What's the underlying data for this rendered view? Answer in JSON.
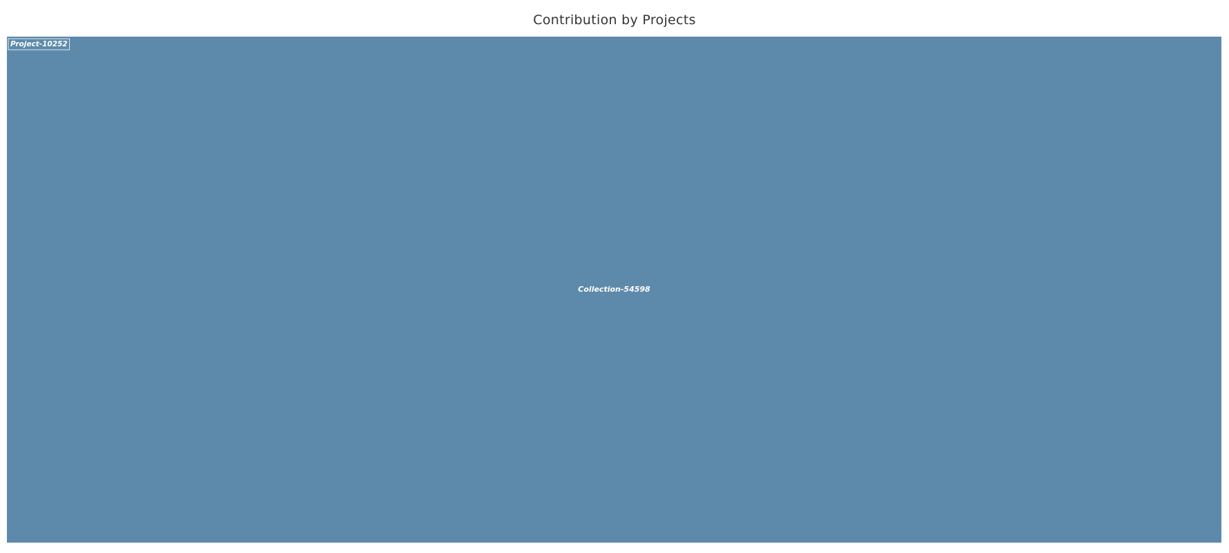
{
  "chart_data": {
    "type": "treemap",
    "title": "Contribution by Projects",
    "root": {
      "name": "Project-10252",
      "children": [
        {
          "name": "Collection-54598",
          "value": 1
        }
      ]
    },
    "colors": {
      "tile": "#5d8aab",
      "label": "#ffffff",
      "title": "#333333"
    }
  }
}
